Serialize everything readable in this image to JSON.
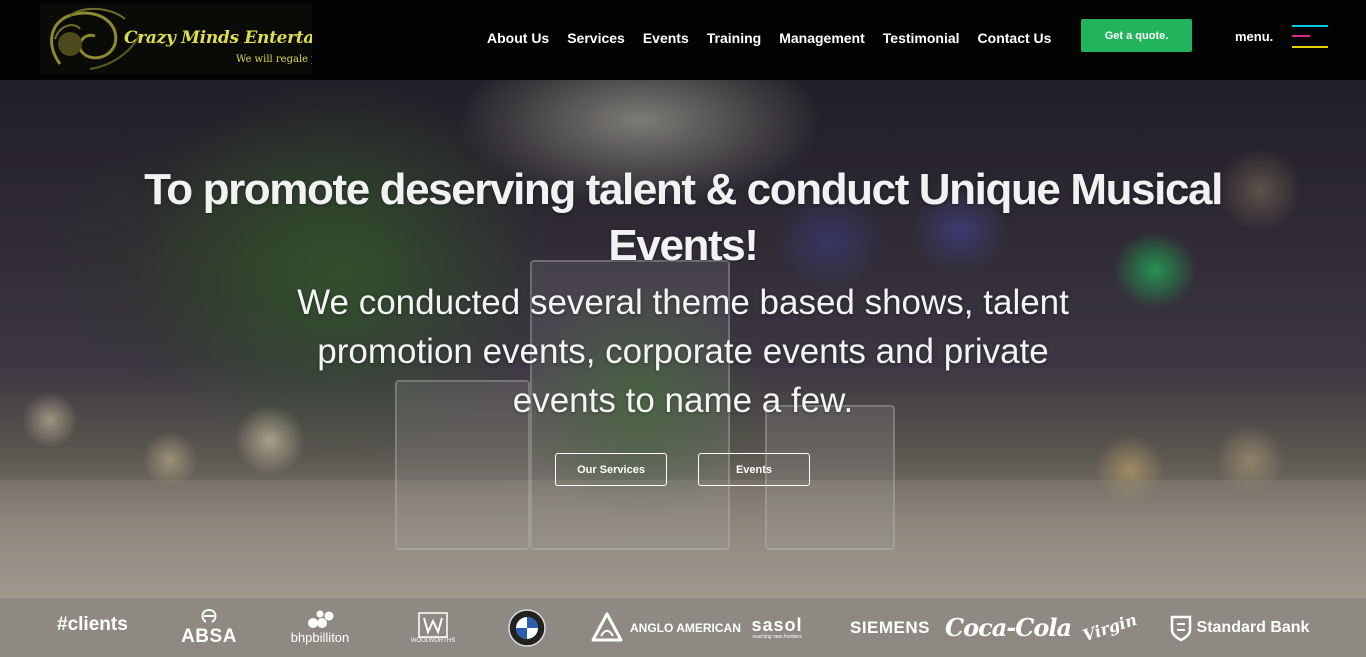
{
  "brand": {
    "name": "Crazy Minds Entertainment",
    "tagline": "We will regale you",
    "logo_color": "#dede4a"
  },
  "nav": {
    "items": [
      {
        "label": "About Us"
      },
      {
        "label": "Services"
      },
      {
        "label": "Events"
      },
      {
        "label": "Training"
      },
      {
        "label": "Management"
      },
      {
        "label": "Testimonial"
      },
      {
        "label": "Contact Us"
      }
    ]
  },
  "header": {
    "quote_button": "Get a quote.",
    "quote_color": "#21b45a",
    "menu_label": "menu.",
    "menu_icon": "hamburger-icon",
    "menu_icon_colors": [
      "#00c8e6",
      "#e0288c",
      "#e6d200"
    ]
  },
  "hero": {
    "title": "To promote deserving talent & conduct Unique Musical Events!",
    "subtitle": "We conducted several theme based shows, talent promotion events, corporate events and private events to name a few.",
    "buttons": {
      "services": "Our Services",
      "events": "Events"
    }
  },
  "clients": {
    "label": "#clients",
    "logos": [
      {
        "name": "ABSA",
        "icon": "absa-logo"
      },
      {
        "name": "bhpbilliton",
        "icon": "bhpbilliton-logo"
      },
      {
        "name": "WOOLWORTHS",
        "icon": "woolworths-logo"
      },
      {
        "name": "BMW",
        "icon": "bmw-logo"
      },
      {
        "name": "ANGLO AMERICAN",
        "icon": "anglo-american-logo"
      },
      {
        "name": "sasol",
        "sub": "reaching new frontiers",
        "icon": "sasol-logo"
      },
      {
        "name": "SIEMENS",
        "icon": "siemens-logo"
      },
      {
        "name": "Coca-Cola",
        "icon": "coca-cola-logo"
      },
      {
        "name": "Virgin",
        "icon": "virgin-logo"
      },
      {
        "name": "Standard Bank",
        "icon": "standard-bank-logo"
      }
    ]
  }
}
